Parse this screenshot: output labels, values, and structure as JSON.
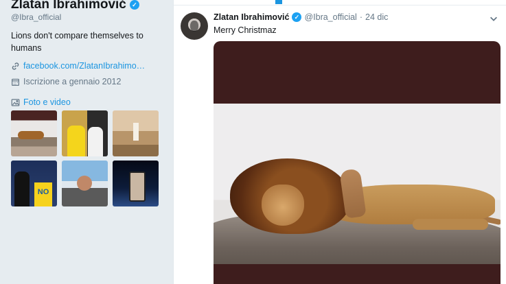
{
  "profile": {
    "name": "Zlatan Ibrahimović",
    "handle": "@Ibra_official",
    "bio": "Lions don't compare themselves to humans",
    "website": "facebook.com/ZlatanIbrahimo…",
    "joined": "Iscrizione a gennaio 2012",
    "media_label": "Foto e video"
  },
  "tweet": {
    "author_name": "Zlatan Ibrahimović",
    "author_handle": "@Ibra_official",
    "separator": "·",
    "date": "24 dic",
    "text": "Merry Christmaz"
  },
  "colors": {
    "accent": "#1da1f2",
    "link": "#1b95e0",
    "background": "#e6ecf0",
    "secondary_text": "#657786"
  },
  "icons": [
    "verified-badge-icon",
    "link-icon",
    "calendar-icon",
    "image-icon",
    "chevron-down-icon"
  ]
}
